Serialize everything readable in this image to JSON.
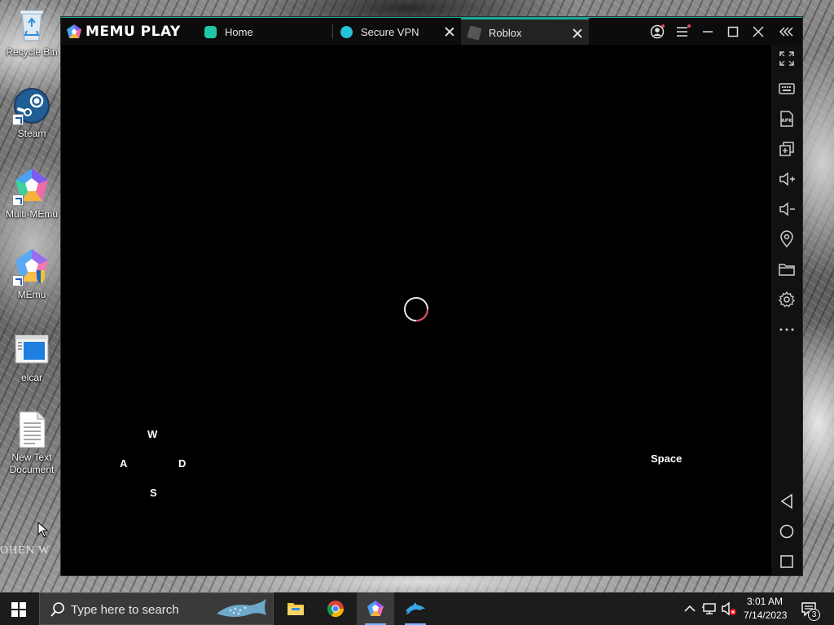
{
  "desktop": {
    "icons": [
      {
        "label": "Recycle Bin"
      },
      {
        "label": "Steam"
      },
      {
        "label": "Multi-MEmu"
      },
      {
        "label": "MEmu"
      },
      {
        "label": "elcar"
      },
      {
        "label": "New Text Document"
      }
    ],
    "wallpaper_text": "OHEN W"
  },
  "emulator": {
    "brand": "MEMU PLAY",
    "tabs": [
      {
        "label": "Home",
        "icon": "home-app-icon",
        "color": "#1fc7a5"
      },
      {
        "label": "Secure VPN",
        "icon": "vpn-app-icon",
        "color": "#25c3d8"
      },
      {
        "label": "Roblox",
        "icon": "roblox-app-icon",
        "color": "#3a3a3a",
        "active": true
      }
    ],
    "accent": "#1aa89a",
    "sidebar_items": [
      "fullscreen",
      "keyboard",
      "apk",
      "multi-window",
      "volume-up",
      "volume-down",
      "location",
      "folder",
      "settings",
      "more",
      "back",
      "home",
      "recents"
    ],
    "keymap": {
      "up": "W",
      "left": "A",
      "right": "D",
      "down": "S",
      "jump": "Space"
    }
  },
  "taskbar": {
    "search_placeholder": "Type here to search",
    "clock_time": "3:01 AM",
    "clock_date": "7/14/2023",
    "notification_count": "3"
  }
}
